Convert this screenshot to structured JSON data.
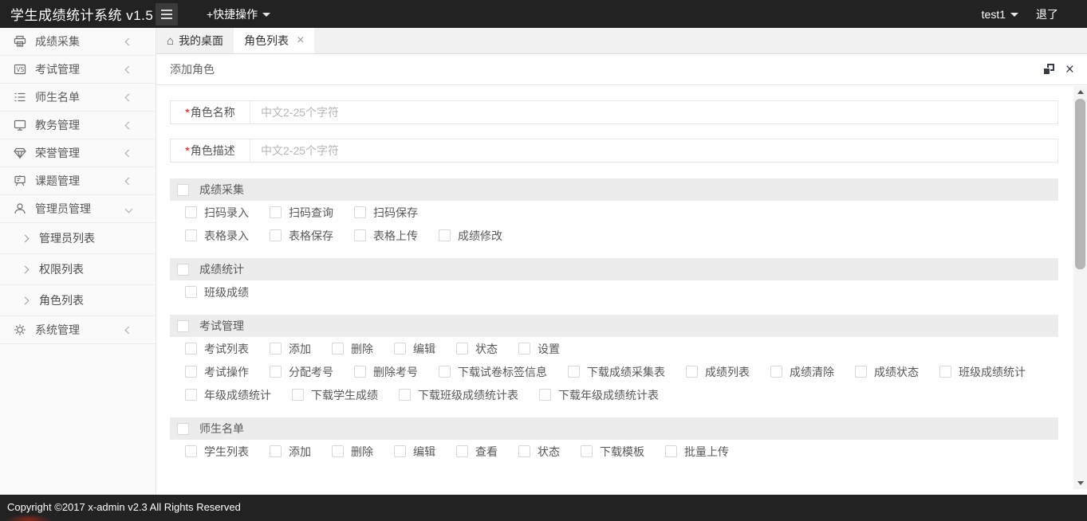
{
  "topbar": {
    "title": "学生成绩统计系统 v1.5",
    "quick_menu": "+快捷操作",
    "username": "test1",
    "logout": "退了"
  },
  "sidebar": {
    "items": [
      {
        "id": "score-collect",
        "icon": "printer-icon",
        "label": "成绩采集"
      },
      {
        "id": "exam-manage",
        "icon": "exam-icon",
        "label": "考试管理"
      },
      {
        "id": "roster",
        "icon": "list-icon",
        "label": "师生名单"
      },
      {
        "id": "academic-manage",
        "icon": "monitor-icon",
        "label": "教务管理"
      },
      {
        "id": "honor-manage",
        "icon": "diamond-icon",
        "label": "荣誉管理"
      },
      {
        "id": "project-manage",
        "icon": "presentation-icon",
        "label": "课题管理"
      },
      {
        "id": "admin-manage",
        "icon": "user-icon",
        "label": "管理员管理",
        "expanded": true,
        "children": [
          {
            "id": "admin-list",
            "label": "管理员列表"
          },
          {
            "id": "permission-list",
            "label": "权限列表"
          },
          {
            "id": "role-list",
            "label": "角色列表"
          }
        ]
      },
      {
        "id": "system-manage",
        "icon": "gear-icon",
        "label": "系统管理"
      }
    ]
  },
  "tabs": [
    {
      "id": "desktop",
      "label": "我的桌面",
      "icon": "home-icon",
      "active": false,
      "closable": false
    },
    {
      "id": "role-list",
      "label": "角色列表",
      "active": true,
      "closable": true
    }
  ],
  "panel": {
    "title": "添加角色"
  },
  "form": {
    "fields": [
      {
        "id": "role-name",
        "label": "角色名称",
        "required": true,
        "value": "",
        "placeholder": "中文2-25个字符"
      },
      {
        "id": "role-desc",
        "label": "角色描述",
        "required": true,
        "value": "",
        "placeholder": "中文2-25个字符"
      }
    ]
  },
  "permission_groups": [
    {
      "id": "score-collect",
      "name": "成绩采集",
      "checked": false,
      "rows": [
        [
          "扫码录入",
          "扫码查询",
          "扫码保存"
        ],
        [
          "表格录入",
          "表格保存",
          "表格上传",
          "成绩修改"
        ]
      ]
    },
    {
      "id": "score-stats",
      "name": "成绩统计",
      "checked": false,
      "rows": [
        [
          "班级成绩"
        ]
      ]
    },
    {
      "id": "exam-manage",
      "name": "考试管理",
      "checked": false,
      "rows": [
        [
          "考试列表",
          "添加",
          "删除",
          "编辑",
          "状态",
          "设置"
        ],
        [
          "考试操作",
          "分配考号",
          "删除考号",
          "下载试卷标签信息",
          "下载成绩采集表",
          "成绩列表",
          "成绩清除",
          "成绩状态",
          "班级成绩统计"
        ],
        [
          "年级成绩统计",
          "下载学生成绩",
          "下载班级成绩统计表",
          "下载年级成绩统计表"
        ]
      ]
    },
    {
      "id": "roster",
      "name": "师生名单",
      "checked": false,
      "rows": [
        [
          "学生列表",
          "添加",
          "删除",
          "编辑",
          "查看",
          "状态",
          "下载模板",
          "批量上传"
        ]
      ]
    }
  ],
  "footer": {
    "copyright": "Copyright ©2017 x-admin v2.3 All Rights Reserved"
  },
  "colors": {
    "topbar_bg": "#222222",
    "footer_bg": "#222222",
    "group_header_bg": "#ececec",
    "active_tab_bg": "#ffffff",
    "panel_icon": "#353b48",
    "required_asterisk": "#ff0000"
  }
}
